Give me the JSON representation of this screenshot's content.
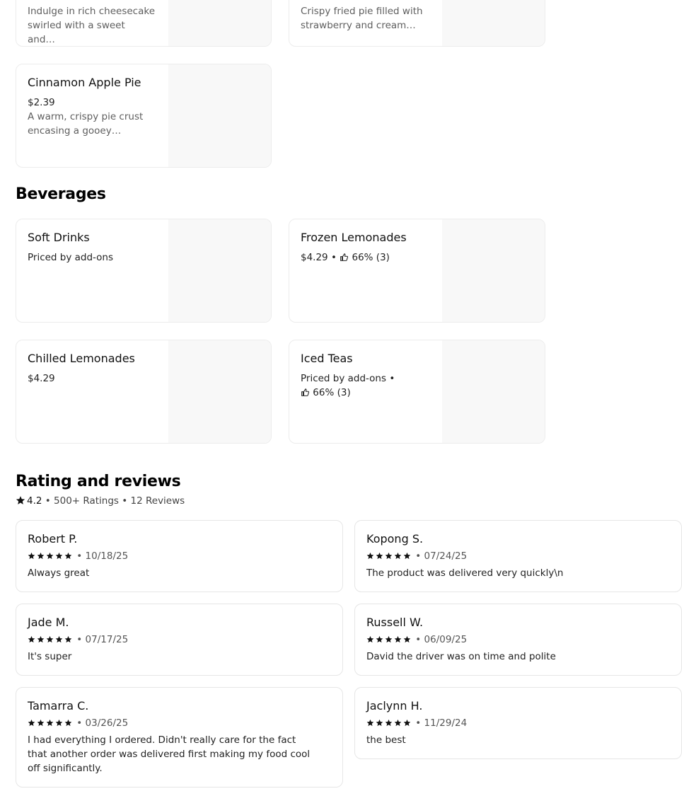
{
  "top_items": [
    {
      "description": "Indulge in rich cheesecake swirled with a sweet and…"
    },
    {
      "description": "Crispy fried pie filled with strawberry and cream…"
    }
  ],
  "desserts_extra": {
    "name": "Cinnamon Apple Pie",
    "price": "$2.39",
    "description": "A warm, crispy pie crust encasing a gooey…"
  },
  "beverages": {
    "title": "Beverages",
    "items": [
      {
        "name": "Soft Drinks",
        "meta": "Priced by add-ons"
      },
      {
        "name": "Frozen Lemonades",
        "price": "$4.29",
        "sep": " • ",
        "rating": "66% (3)"
      },
      {
        "name": "Chilled Lemonades",
        "meta": "$4.29"
      },
      {
        "name": "Iced Teas",
        "price": "Priced by add-ons",
        "sep": " • ",
        "rating": "66% (3)"
      }
    ]
  },
  "reviews_section": {
    "title": "Rating and reviews",
    "score": "4.2",
    "ratings_count": "500+ Ratings",
    "reviews_count": "12 Reviews",
    "sep": " • ",
    "reviews": [
      {
        "name": "Robert P.",
        "date": "10/18/25",
        "text": "Always great"
      },
      {
        "name": "Kopong S.",
        "date": "07/24/25",
        "text": "The product was delivered very quickly\\n"
      },
      {
        "name": "Jade M.",
        "date": "07/17/25",
        "text": "It's super"
      },
      {
        "name": "Russell W.",
        "date": "06/09/25",
        "text": "David the driver was on time and polite"
      },
      {
        "name": "Tamarra C.",
        "date": "03/26/25",
        "text": "I had everything I ordered. Didn't really care for the fact that another order was delivered first making my food cool off significantly."
      },
      {
        "name": "Jaclynn H.",
        "date": "11/29/24",
        "text": "the best"
      }
    ],
    "star_rating": 5
  },
  "colors": {
    "border": "#ececec",
    "image_placeholder": "#f8f8f8",
    "muted_text": "#5e5e5e"
  }
}
